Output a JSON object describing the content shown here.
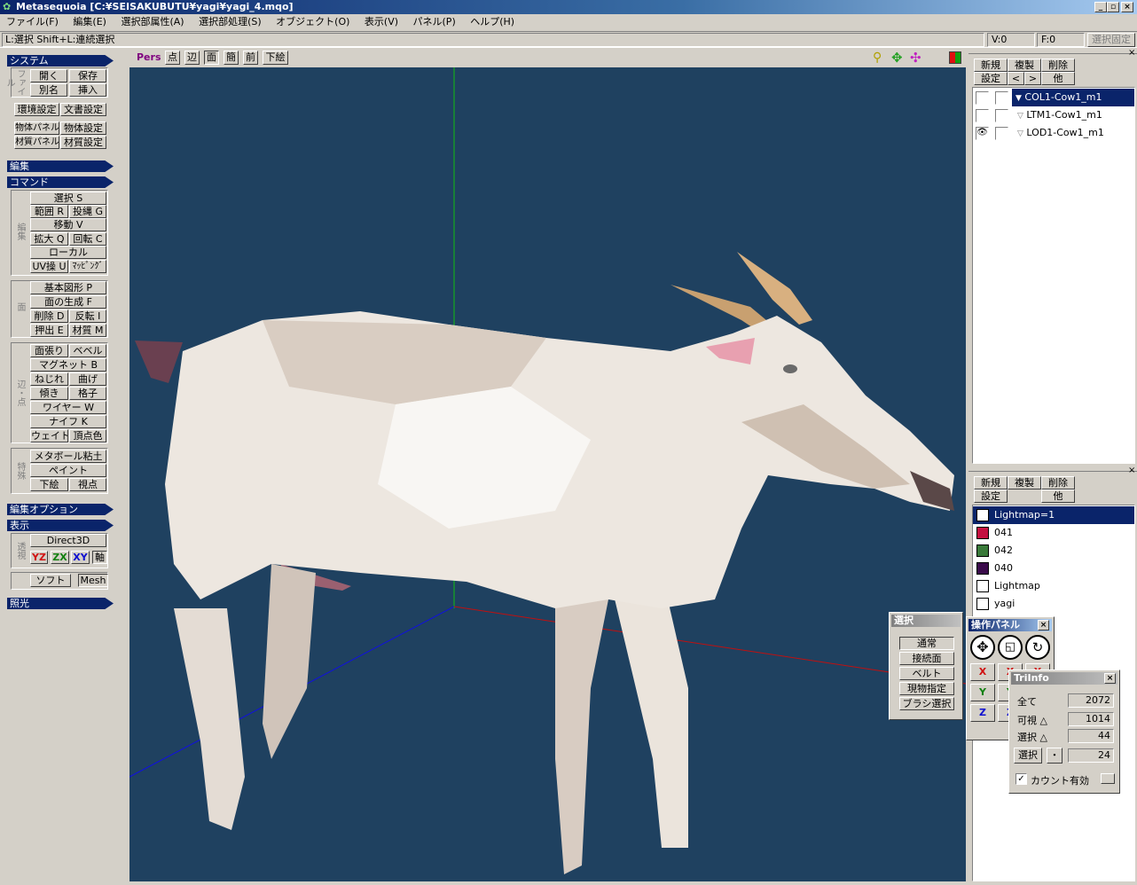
{
  "window": {
    "title": "Metasequoia [C:¥SEISAKUBUTU¥yagi¥yagi_4.mqo]"
  },
  "menu": [
    "ファイル(F)",
    "編集(E)",
    "選択部属性(A)",
    "選択部処理(S)",
    "オブジェクト(O)",
    "表示(V)",
    "パネル(P)",
    "ヘルプ(H)"
  ],
  "status": {
    "hint": "L:選択  Shift+L:連続選択",
    "v": "V:0",
    "f": "F:0",
    "lock_label": "選択固定"
  },
  "view_toolbar": {
    "mode": "Pers",
    "buttons": [
      "点",
      "辺",
      "面",
      "簡",
      "前",
      "下絵"
    ]
  },
  "left": {
    "system": "システム",
    "file_group": "ファイル",
    "open": "開く",
    "save": "保存",
    "rename": "別名",
    "insert": "挿入",
    "env": "環境設定",
    "doc": "文書設定",
    "obj_panel": "物体パネル",
    "obj_settings": "物体設定",
    "mat_panel": "材質パネル",
    "mat_settings": "材質設定",
    "edit_section": "編集",
    "command_section": "コマンド",
    "edit_group": "編集",
    "select": "選択 S",
    "range": "範囲 R",
    "lasso": "投縄 G",
    "move": "移動 V",
    "scale": "拡大 Q",
    "rotate": "回転 C",
    "local": "ローカル",
    "uv": "UV操 U",
    "mapping": "ﾏｯﾋﾟﾝｸﾞ",
    "face_group": "面",
    "primitive": "基本図形 P",
    "face_gen": "面の生成 F",
    "delete": "削除 D",
    "invert": "反転 I",
    "extrude": "押出 E",
    "material": "材質 M",
    "edge_group": "辺・点",
    "face_stretch": "面張り",
    "bevel": "ベベル",
    "magnet": "マグネット B",
    "twist": "ねじれ",
    "bend": "曲げ",
    "tilt": "傾き",
    "lattice": "格子",
    "wire": "ワイヤー W",
    "knife": "ナイフ K",
    "weight": "ウェイト",
    "vcolor": "頂点色",
    "special_group": "特殊",
    "metaball": "メタボール粘土",
    "paint": "ペイント",
    "underlay": "下絵",
    "viewpoint": "視点",
    "edit_option_section": "編集オプション",
    "display_section": "表示",
    "persp_group": "透視",
    "direct3d": "Direct3D",
    "yz": "YZ",
    "zx": "ZX",
    "xy": "XY",
    "axis": "軸",
    "soft": "ソフト",
    "mesh": "Mesh",
    "lighting_section": "照光"
  },
  "object_panel": {
    "new": "新規",
    "copy": "複製",
    "delete": "削除",
    "settings": "設定",
    "prev": "<",
    "next": ">",
    "other": "他",
    "objects": [
      {
        "name": "COL1-Cow1_m1",
        "selected": true,
        "visible": false
      },
      {
        "name": "LTM1-Cow1_m1",
        "selected": false,
        "visible": false
      },
      {
        "name": "LOD1-Cow1_m1",
        "selected": false,
        "visible": true
      }
    ]
  },
  "material_panel": {
    "new": "新規",
    "copy": "複製",
    "delete": "削除",
    "settings": "設定",
    "other": "他",
    "materials": [
      {
        "name": "Lightmap=1",
        "color": "#ffffff",
        "selected": true
      },
      {
        "name": "041",
        "color": "#c41040",
        "selected": false
      },
      {
        "name": "042",
        "color": "#3a7a3a",
        "selected": false
      },
      {
        "name": "040",
        "color": "#3a0a4a",
        "selected": false
      },
      {
        "name": "Lightmap",
        "color": "#ffffff",
        "selected": false
      },
      {
        "name": "yagi",
        "color": "#ffffff",
        "selected": false
      }
    ]
  },
  "select_panel": {
    "title": "選択",
    "items": [
      "通常",
      "接続面",
      "ベルト",
      "現物指定",
      "ブラシ選択"
    ]
  },
  "op_panel": {
    "title": "操作パネル",
    "close": "×",
    "x": "X",
    "y": "Y",
    "z": "Z"
  },
  "triinfo": {
    "title": "TriInfo",
    "close": "×",
    "all_label": "全て",
    "all_value": "2072",
    "visible_label": "可視 △",
    "visible_value": "1014",
    "selected_label": "選択 △",
    "selected_value": "44",
    "select_btn": "選択",
    "dot_btn": "・",
    "select_value": "24",
    "count_label": "カウント有効"
  }
}
